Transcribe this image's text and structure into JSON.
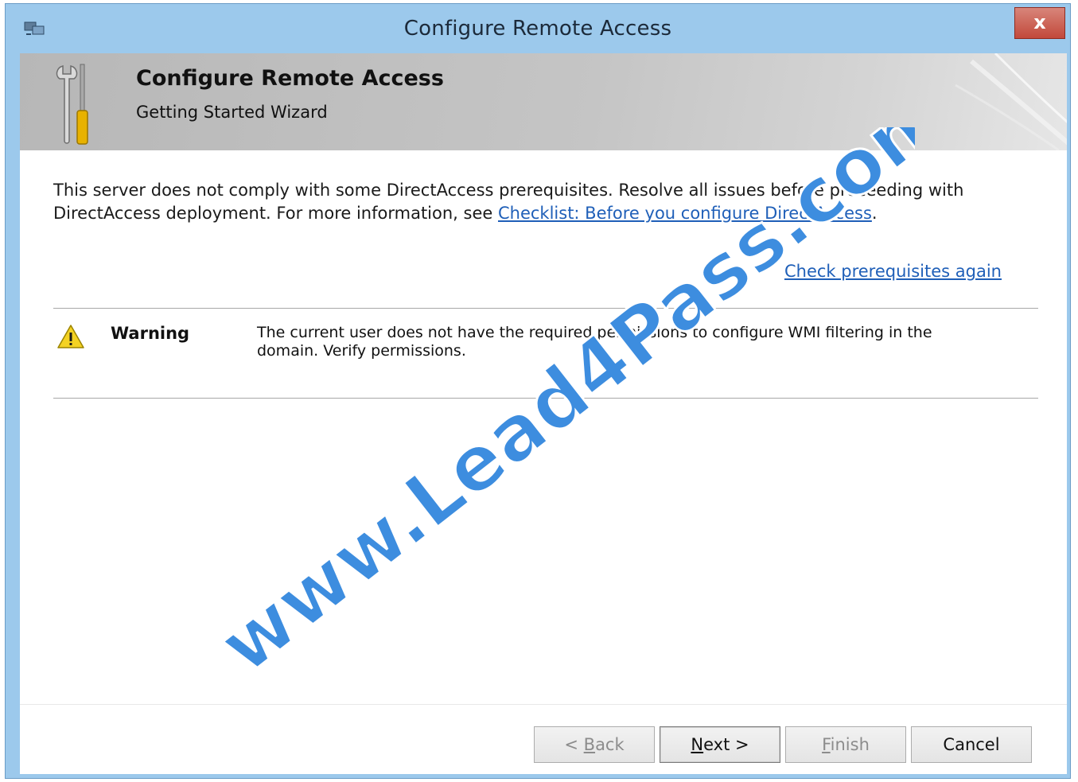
{
  "window": {
    "title": "Configure Remote Access",
    "close_label": "x"
  },
  "banner": {
    "heading": "Configure Remote Access",
    "subheading": "Getting Started Wizard"
  },
  "intro": {
    "text": "This server does not comply with some DirectAccess prerequisites. Resolve all issues before proceeding with DirectAccess deployment. For more information, see ",
    "link_text": "Checklist: Before you configure DirectAccess",
    "trailing": "."
  },
  "recheck_link": "Check prerequisites again",
  "issues": [
    {
      "severity": "Warning",
      "icon": "warning-icon",
      "message": "The current user does not have the required permissions to configure WMI filtering in the domain. Verify permissions."
    }
  ],
  "buttons": {
    "back": {
      "prefix": "< ",
      "mnemonic": "B",
      "rest": "ack"
    },
    "next": {
      "mnemonic": "N",
      "rest": "ext >"
    },
    "finish": {
      "mnemonic": "F",
      "rest": "inish"
    },
    "cancel": "Cancel"
  },
  "watermark": "www.Lead4Pass.com",
  "colors": {
    "link": "#1f5fb8",
    "titlebar": "#9cc9ec",
    "close": "#c2493b",
    "watermark": "#3d8ddf"
  }
}
